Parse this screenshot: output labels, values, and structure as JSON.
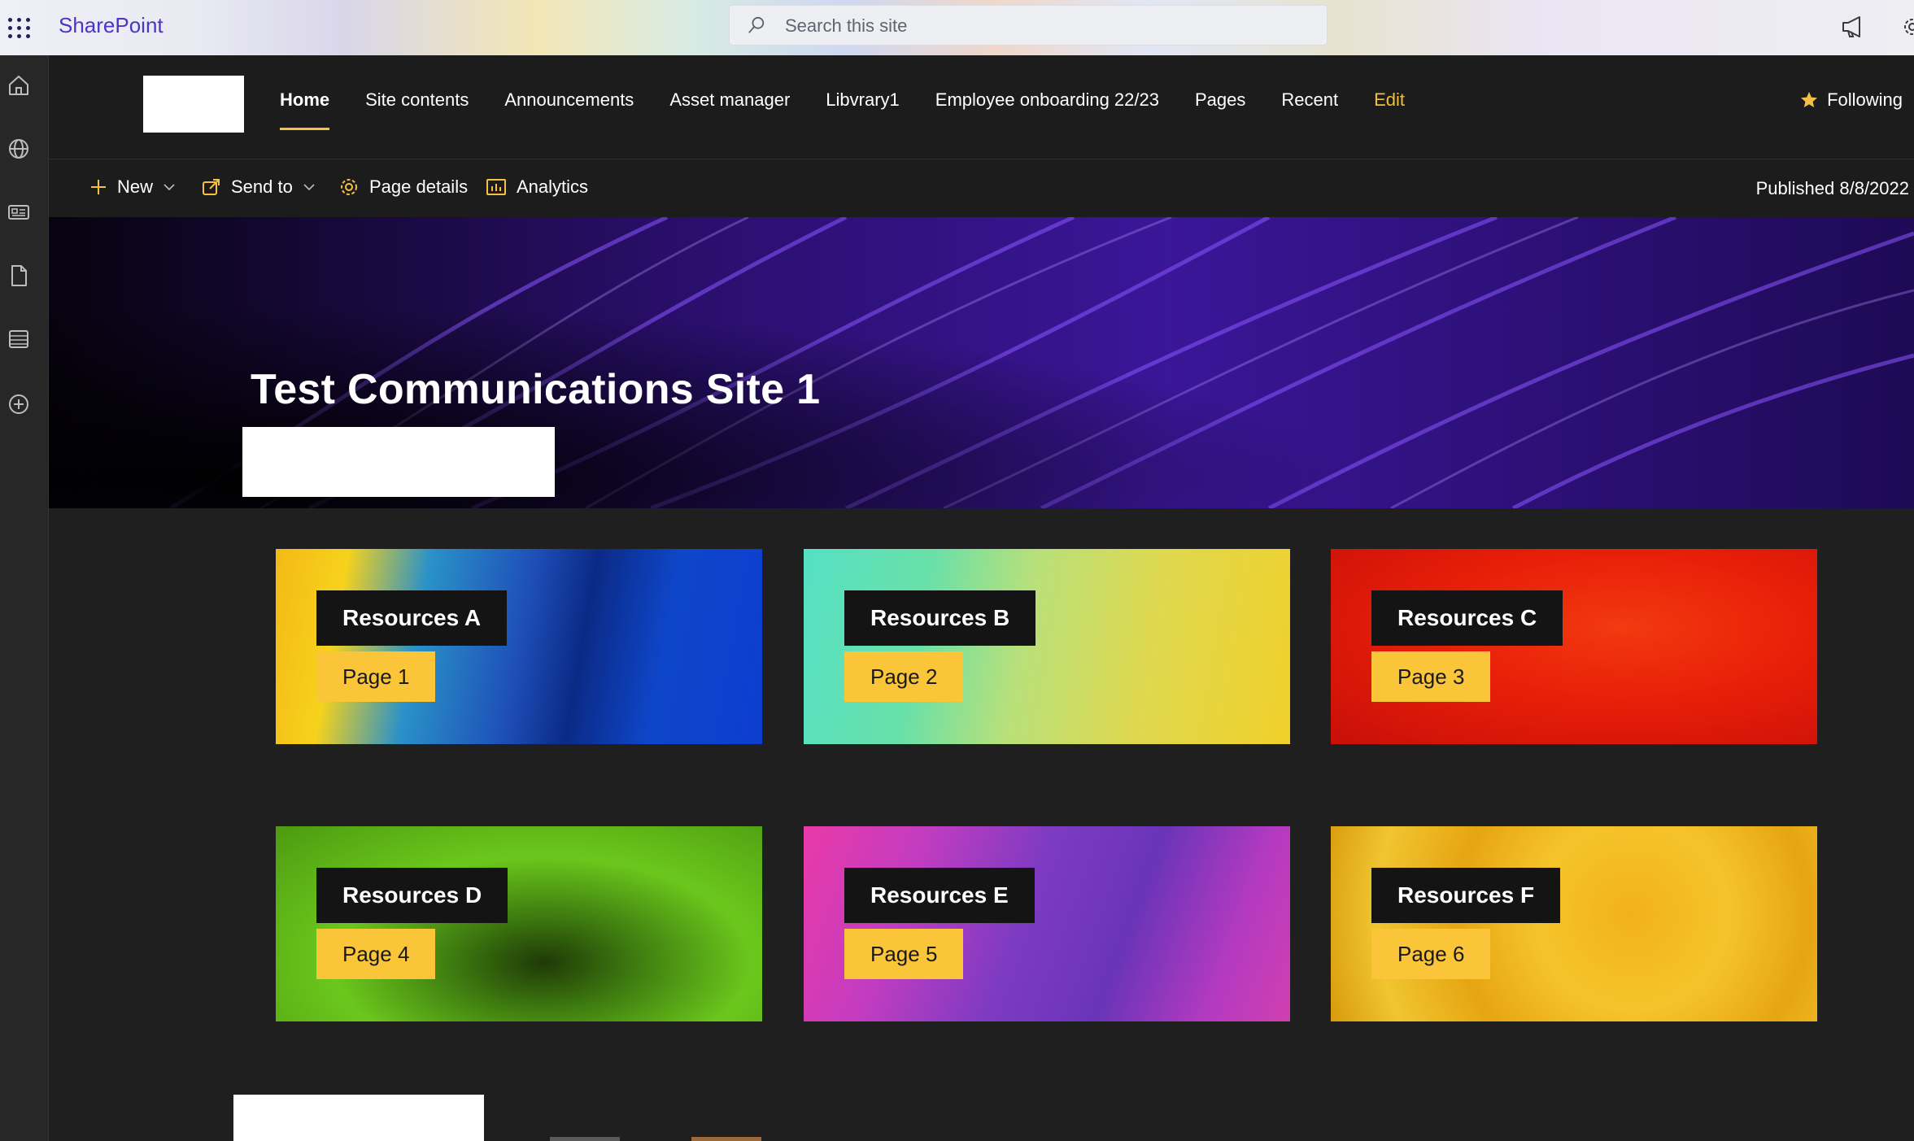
{
  "suitebar": {
    "brand": "SharePoint",
    "search_placeholder": "Search this site"
  },
  "nav": {
    "items": [
      {
        "label": "Home",
        "active": true
      },
      {
        "label": "Site contents"
      },
      {
        "label": "Announcements"
      },
      {
        "label": "Asset manager"
      },
      {
        "label": "Libvrary1"
      },
      {
        "label": "Employee onboarding 22/23"
      },
      {
        "label": "Pages"
      },
      {
        "label": "Recent"
      },
      {
        "label": "Edit"
      }
    ],
    "following": "Following"
  },
  "commandbar": {
    "new": "New",
    "send_to": "Send to",
    "page_details": "Page details",
    "analytics": "Analytics",
    "published": "Published 8/8/2022"
  },
  "hero": {
    "title": "Test Communications Site 1"
  },
  "tiles": [
    {
      "title": "Resources A",
      "page": "Page 1"
    },
    {
      "title": "Resources B",
      "page": "Page 2"
    },
    {
      "title": "Resources C",
      "page": "Page 3"
    },
    {
      "title": "Resources D",
      "page": "Page 4"
    },
    {
      "title": "Resources E",
      "page": "Page 5"
    },
    {
      "title": "Resources F",
      "page": "Page 6"
    }
  ],
  "colors": {
    "accent": "#f5c144",
    "brand": "#4f33c8",
    "page_bg": "#1f1f1f"
  }
}
